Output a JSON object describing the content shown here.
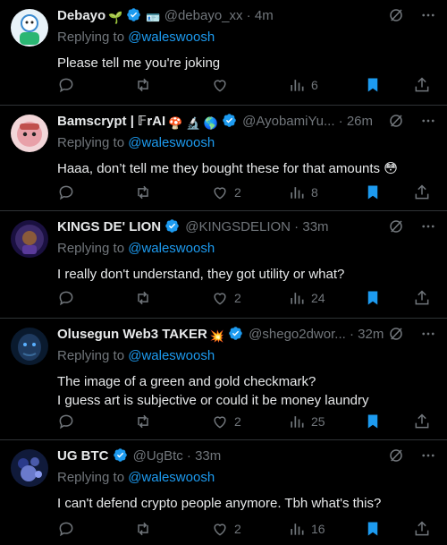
{
  "replies": [
    {
      "name": "Debayo",
      "name_emojis": "🌱",
      "extra_badge": "🪪",
      "handle": "@debayo_xx",
      "time": "4m",
      "replying_prefix": "Replying to",
      "mention": "@waleswoosh",
      "text_lines": [
        "Please tell me you're joking"
      ],
      "reply_count": "",
      "like_count": "",
      "view_count": "6",
      "avatar_color": "#3a8bd0"
    },
    {
      "name": "Bamscrypt | 𝔽rAI",
      "name_emojis": "🍄 🔬 🌎",
      "handle": "@AyobamiYu...",
      "time": "26m",
      "replying_prefix": "Replying to",
      "mention": "@waleswoosh",
      "text_lines": [
        "Haaa, don’t tell me they bought these for that amounts 😳"
      ],
      "reply_count": "",
      "like_count": "2",
      "view_count": "8",
      "avatar_color": "#e8a0a8"
    },
    {
      "name": "KINGS DE' LION",
      "name_emojis": "",
      "handle": "@KINGSDELION",
      "time": "33m",
      "replying_prefix": "Replying to",
      "mention": "@waleswoosh",
      "text_lines": [
        "I really don't understand, they got utility or what?"
      ],
      "reply_count": "",
      "like_count": "2",
      "view_count": "24",
      "avatar_color": "#3b2a6a"
    },
    {
      "name": "Olusegun Web3 TAKER",
      "name_emojis": "💥",
      "handle": "@shego2dwor...",
      "time": "32m",
      "replying_prefix": "Replying to",
      "mention": "@waleswoosh",
      "text_lines": [
        "The image of a green and gold checkmark?",
        "I guess art is subjective or could it be money laundry"
      ],
      "reply_count": "",
      "like_count": "2",
      "view_count": "25",
      "avatar_color": "#1e3a5f"
    },
    {
      "name": "UG BTC",
      "name_emojis": "",
      "handle": "@UgBtc",
      "time": "33m",
      "replying_prefix": "Replying to",
      "mention": "@waleswoosh",
      "text_lines": [
        "I can't defend crypto people anymore. Tbh what's this?"
      ],
      "reply_count": "",
      "like_count": "2",
      "view_count": "16",
      "avatar_color": "#2a3a8a"
    }
  ],
  "colors": {
    "accent": "#1d9bf0",
    "muted": "#71767b",
    "text": "#e7e9ea",
    "background": "#000000"
  },
  "icons": [
    "reply-icon",
    "retweet-icon",
    "like-icon",
    "views-icon",
    "bookmark-icon",
    "share-icon",
    "grok-icon",
    "more-icon",
    "verified-icon"
  ]
}
